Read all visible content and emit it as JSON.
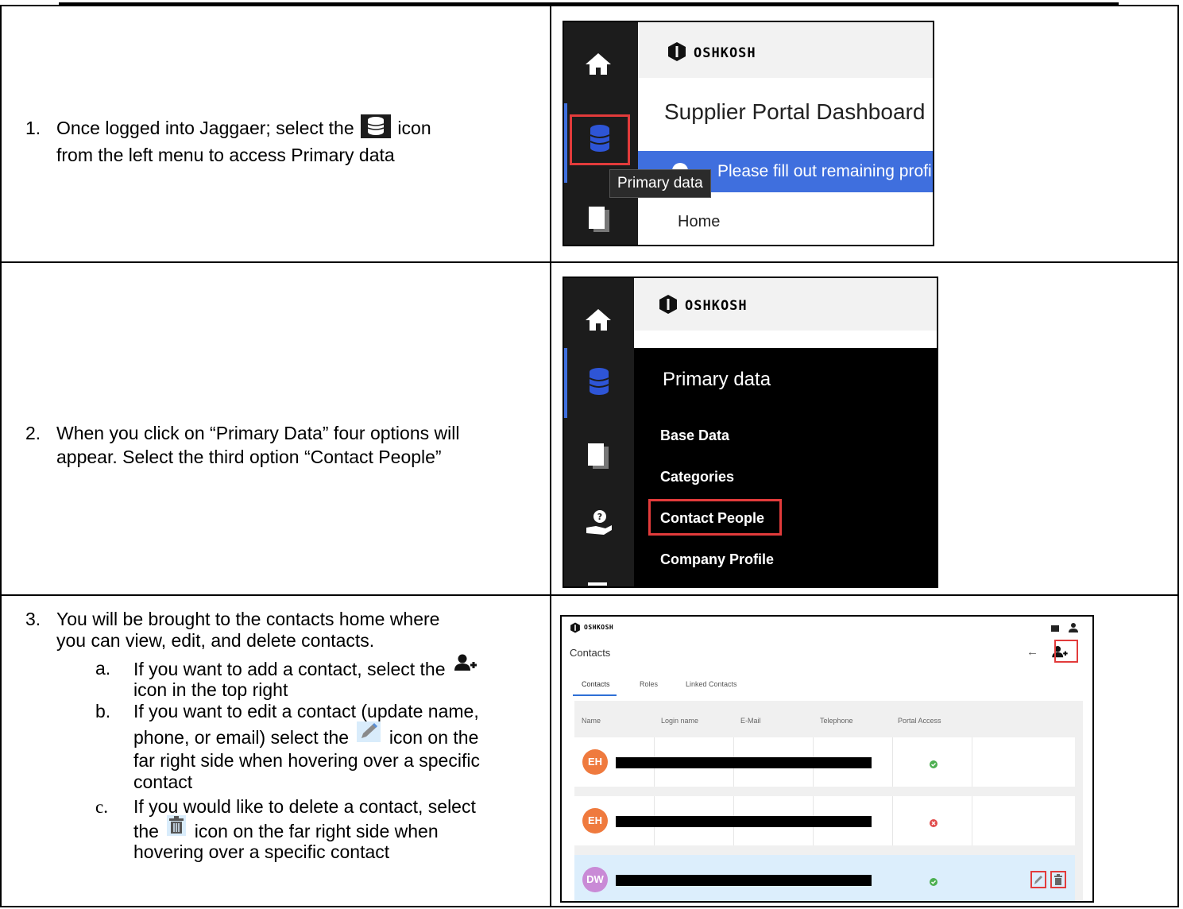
{
  "step1": {
    "number": "1.",
    "text_before": "Once logged into Jaggaer; select the",
    "text_after_icon": "icon",
    "text_line2": "from the left menu to access Primary data",
    "shot": {
      "brand": "OSHKOSH",
      "dashboard_title": "Supplier Portal Dashboard",
      "banner_text": "Please fill out remaining profile",
      "tooltip": "Primary data",
      "home_link": "Home"
    }
  },
  "step2": {
    "number": "2.",
    "line1": "When you click on “Primary Data” four options will",
    "line2": "appear. Select the third option “Contact People”",
    "shot": {
      "brand": "OSHKOSH",
      "menu_title": "Primary data",
      "menu_items": [
        "Base Data",
        "Categories",
        "Contact People",
        "Company Profile"
      ]
    }
  },
  "step3": {
    "number": "3.",
    "line1": "You will be brought to the contacts home where",
    "line2": "you can view, edit, and delete contacts.",
    "a_label": "a.",
    "a_line1_before": "If you want to add a contact, select the",
    "a_line2": "icon in the top right",
    "b_label": "b.",
    "b_line1": "If you want to edit a contact (update name,",
    "b_line2_before": "phone, or email) select the",
    "b_line2_after": "icon on the",
    "b_line3": "far right side when hovering over a specific",
    "b_line4": "contact",
    "c_label": "c.",
    "c_line1": "If you would like to delete a contact, select",
    "c_line2_before": "the",
    "c_line2_after": "icon on the far right side when",
    "c_line3": "hovering over a specific contact",
    "shot": {
      "brand": "OSHKOSH",
      "page_title": "Contacts",
      "tabs": [
        "Contacts",
        "Roles",
        "Linked Contacts"
      ],
      "columns": [
        "Name",
        "Login name",
        "E-Mail",
        "Telephone",
        "Portal Access"
      ],
      "rows": [
        {
          "initials": "EH",
          "avatar_color": "#ef7a3e",
          "access": "yes"
        },
        {
          "initials": "EH",
          "avatar_color": "#ef7a3e",
          "access": "no"
        },
        {
          "initials": "DW",
          "avatar_color": "#c98ad6",
          "access": "yes"
        }
      ]
    }
  },
  "colors": {
    "highlight": "#e23b3b",
    "banner_blue": "#3f6fde",
    "db_icon_blue": "#2e55d6",
    "sidebar": "#1c1c1c",
    "check_green": "#4caf50",
    "cross_red": "#e14a4a",
    "hover_row": "#dceefc"
  }
}
